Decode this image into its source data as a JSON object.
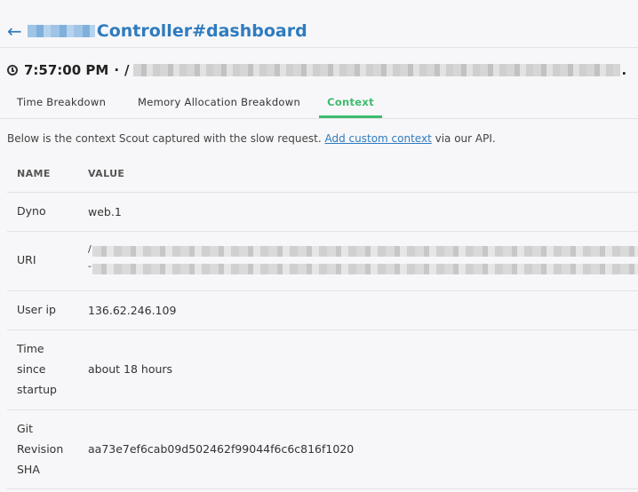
{
  "header": {
    "back_arrow": "←",
    "title": "Controller#dashboard",
    "time": "7:57:00 PM",
    "separator": "·",
    "path_prefix": "/",
    "path_suffix": "."
  },
  "tabs": [
    {
      "label": "Time Breakdown",
      "active": false
    },
    {
      "label": "Memory Allocation Breakdown",
      "active": false
    },
    {
      "label": "Context",
      "active": true
    }
  ],
  "intro": {
    "before": "Below is the context Scout captured with the slow request. ",
    "link": "Add custom context",
    "after": " via our API."
  },
  "table": {
    "headers": {
      "name": "NAME",
      "value": "VALUE"
    },
    "rows": [
      {
        "name": "Dyno",
        "value": "web.1"
      },
      {
        "name": "URI",
        "value_prefix_1": "/",
        "value_prefix_2": "-"
      },
      {
        "name": "User ip",
        "value": "136.62.246.109"
      },
      {
        "name_lines": [
          "Time",
          "since",
          "startup"
        ],
        "value": "about 18 hours"
      },
      {
        "name_lines": [
          "Git",
          "Revision",
          "SHA"
        ],
        "value": "aa73e7ef6cab09d502462f99044f6c6c816f1020"
      }
    ]
  },
  "colors": {
    "link": "#2f7bbf",
    "active_tab": "#3fbb6c",
    "background": "#f7f7f9"
  },
  "icons": [
    "back-arrow-icon",
    "clock-icon"
  ]
}
